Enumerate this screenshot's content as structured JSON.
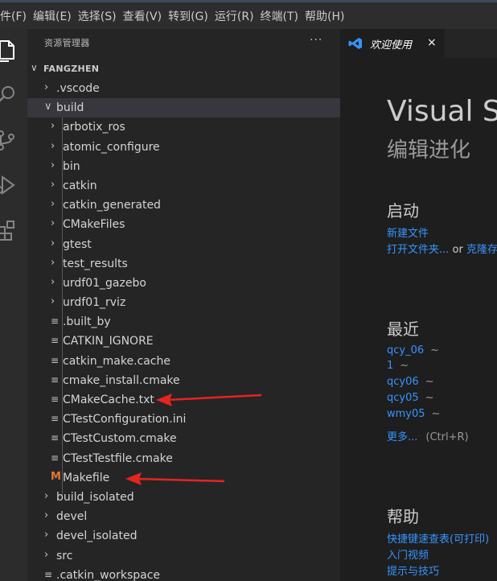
{
  "menubar": {
    "items": [
      "文件(F)",
      "编辑(E)",
      "选择(S)",
      "查看(V)",
      "转到(G)",
      "运行(R)",
      "终端(T)",
      "帮助(H)"
    ]
  },
  "activity": {
    "icons": [
      "explorer-icon",
      "search-icon",
      "source-control-icon",
      "run-debug-icon",
      "extensions-icon"
    ]
  },
  "explorer": {
    "title": "资源管理器",
    "more": "···",
    "root": "FANGZHEN",
    "tree": [
      {
        "label": ".vscode",
        "kind": "folder",
        "depth": 0,
        "open": false
      },
      {
        "label": "build",
        "kind": "folder",
        "depth": 0,
        "open": true,
        "selected": true
      },
      {
        "label": "arbotix_ros",
        "kind": "folder",
        "depth": 1,
        "open": false
      },
      {
        "label": "atomic_configure",
        "kind": "folder",
        "depth": 1,
        "open": false
      },
      {
        "label": "bin",
        "kind": "folder",
        "depth": 1,
        "open": false
      },
      {
        "label": "catkin",
        "kind": "folder",
        "depth": 1,
        "open": false
      },
      {
        "label": "catkin_generated",
        "kind": "folder",
        "depth": 1,
        "open": false
      },
      {
        "label": "CMakeFiles",
        "kind": "folder",
        "depth": 1,
        "open": false
      },
      {
        "label": "gtest",
        "kind": "folder",
        "depth": 1,
        "open": false
      },
      {
        "label": "test_results",
        "kind": "folder",
        "depth": 1,
        "open": false
      },
      {
        "label": "urdf01_gazebo",
        "kind": "folder",
        "depth": 1,
        "open": false
      },
      {
        "label": "urdf01_rviz",
        "kind": "folder",
        "depth": 1,
        "open": false
      },
      {
        "label": ".built_by",
        "kind": "file",
        "depth": 1
      },
      {
        "label": "CATKIN_IGNORE",
        "kind": "file",
        "depth": 1
      },
      {
        "label": "catkin_make.cache",
        "kind": "file",
        "depth": 1
      },
      {
        "label": "cmake_install.cmake",
        "kind": "file",
        "depth": 1
      },
      {
        "label": "CMakeCache.txt",
        "kind": "file",
        "depth": 1
      },
      {
        "label": "CTestConfiguration.ini",
        "kind": "file",
        "depth": 1
      },
      {
        "label": "CTestCustom.cmake",
        "kind": "file",
        "depth": 1
      },
      {
        "label": "CTestTestfile.cmake",
        "kind": "file",
        "depth": 1
      },
      {
        "label": "Makefile",
        "kind": "makefile",
        "depth": 1
      },
      {
        "label": "build_isolated",
        "kind": "folder",
        "depth": 0,
        "open": false
      },
      {
        "label": "devel",
        "kind": "folder",
        "depth": 0,
        "open": false
      },
      {
        "label": "devel_isolated",
        "kind": "folder",
        "depth": 0,
        "open": false
      },
      {
        "label": "src",
        "kind": "folder",
        "depth": 0,
        "open": false
      },
      {
        "label": ".catkin_workspace",
        "kind": "file",
        "depth": 0
      }
    ]
  },
  "editor": {
    "tab_label": "欢迎使用",
    "tab_close": "×",
    "welcome": {
      "title": "Visual S",
      "subtitle": "编辑进化",
      "start_heading": "启动",
      "new_file": "新建文件",
      "open_folder": "打开文件夹...",
      "or_text": " or ",
      "clone": "克隆存",
      "recent_heading": "最近",
      "recent": [
        {
          "name": "qcy_06",
          "path": "~"
        },
        {
          "name": "1",
          "path": "~"
        },
        {
          "name": "qcy06",
          "path": "~"
        },
        {
          "name": "qcy05",
          "path": "~"
        },
        {
          "name": "wmy05",
          "path": "~"
        }
      ],
      "more": "更多...",
      "more_shortcut": "(Ctrl+R)",
      "help_heading": "帮助",
      "help_links": [
        "快捷键速查表(可打印)",
        "入门视频",
        "提示与技巧"
      ]
    }
  },
  "annotation_color": "#e8231f"
}
